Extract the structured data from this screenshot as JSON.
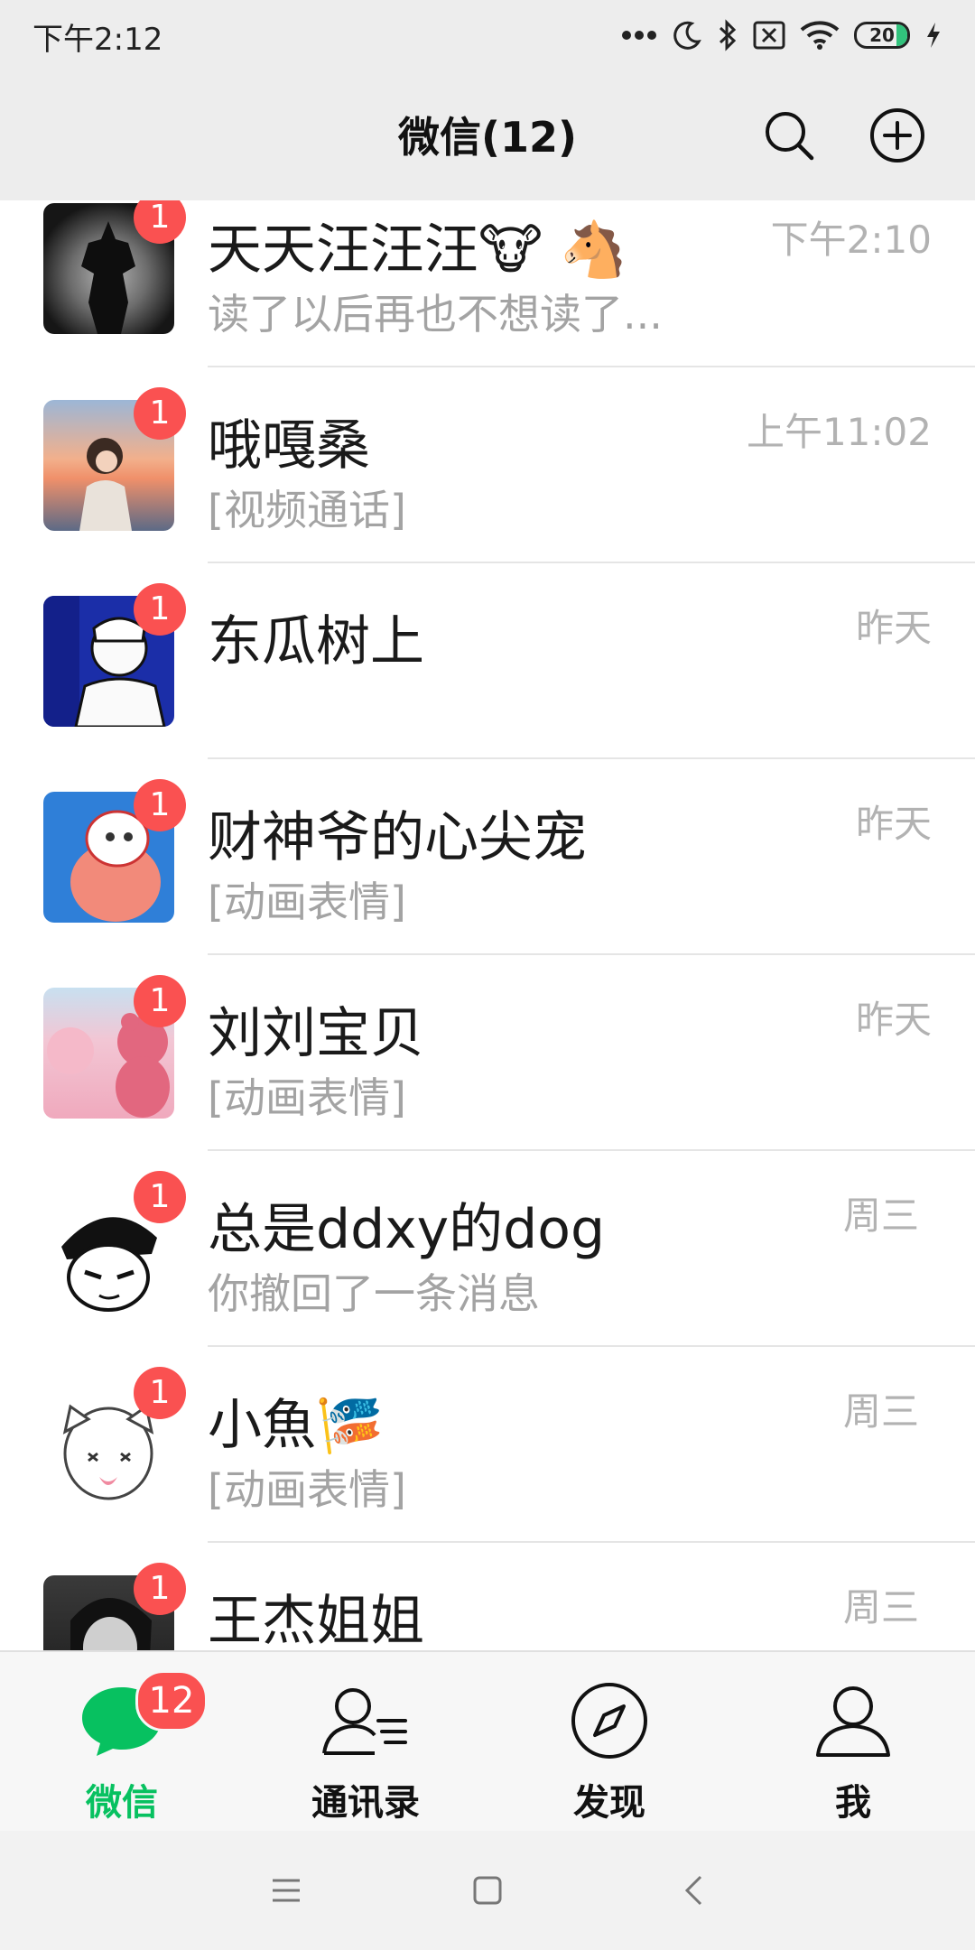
{
  "status_bar": {
    "time": "下午2:12",
    "battery": "20"
  },
  "header": {
    "title": "微信(12)",
    "icons": [
      "search-icon",
      "add-circle-icon"
    ]
  },
  "chats": [
    {
      "name": "天天汪汪汪🐮 🐴",
      "preview": "读了以后再也不想读了...",
      "time": "下午2:10",
      "unread": "1",
      "avatar_colors": [
        "#1a1a1a",
        "#8a8a8a"
      ]
    },
    {
      "name": "哦嘎桑",
      "preview": "[视频通话]",
      "time": "上午11:02",
      "unread": "1",
      "avatar_colors": [
        "#f3a37a",
        "#6d7fa6"
      ]
    },
    {
      "name": "东瓜树上",
      "preview": "",
      "time": "昨天",
      "unread": "1",
      "avatar_colors": [
        "#1b2ea8",
        "#f4f4f4"
      ]
    },
    {
      "name": "财神爷的心尖宠",
      "preview": "[动画表情]",
      "time": "昨天",
      "unread": "1",
      "avatar_colors": [
        "#2f7fd8",
        "#f28a7a"
      ]
    },
    {
      "name": "刘刘宝贝",
      "preview": "[动画表情]",
      "time": "昨天",
      "unread": "1",
      "avatar_colors": [
        "#f2b8c8",
        "#e2677f"
      ]
    },
    {
      "name": "总是ddxy的dog",
      "preview": "你撤回了一条消息",
      "time": "周三",
      "unread": "1",
      "avatar_colors": [
        "#ffffff",
        "#111111"
      ]
    },
    {
      "name": "小魚🎏",
      "preview": "[动画表情]",
      "time": "周三",
      "unread": "1",
      "avatar_colors": [
        "#ffffff",
        "#555555"
      ]
    },
    {
      "name": "王杰姐姐",
      "preview": "",
      "time": "周三",
      "unread": "1",
      "avatar_colors": [
        "#2a2a2a",
        "#cfcfcf"
      ]
    }
  ],
  "tabs": [
    {
      "label": "微信",
      "icon": "chat-bubble-icon",
      "badge": "12",
      "active": true
    },
    {
      "label": "通讯录",
      "icon": "contacts-icon"
    },
    {
      "label": "发现",
      "icon": "compass-icon"
    },
    {
      "label": "我",
      "icon": "person-icon"
    }
  ],
  "colors": {
    "accent": "#07c160",
    "badge": "#fa5151",
    "header_bg": "#ededed"
  }
}
